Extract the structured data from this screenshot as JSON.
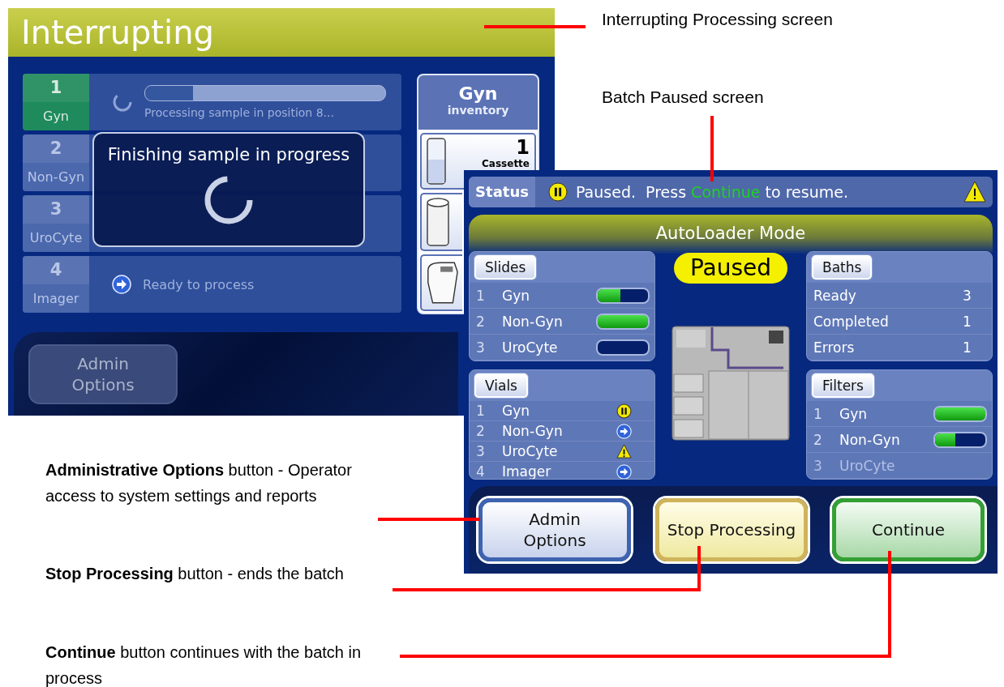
{
  "callouts": [
    {
      "text": "Interrupting Processing screen"
    },
    {
      "text": "Batch Paused screen"
    }
  ],
  "descriptions": [
    {
      "text": "**Administrative Options** button - Operator access to system settings and reports"
    },
    {
      "text": "**Stop Processing** button - ends the batch"
    },
    {
      "text": "**Continue** button continues with the batch in process"
    }
  ],
  "interrupting_screen": {
    "title": "Interrupting",
    "queues": [
      {
        "number": "1",
        "name": "Gyn",
        "selected": true,
        "kind": "progress",
        "message": "Processing sample in position 8...",
        "level": 0.2
      },
      {
        "number": "2",
        "name": "Non-Gyn",
        "selected": false,
        "kind": "hidden"
      },
      {
        "number": "3",
        "name": "UroCyte",
        "selected": false,
        "kind": "hidden"
      },
      {
        "number": "4",
        "name": "Imager",
        "selected": false,
        "kind": "ready",
        "message": "Ready to process"
      }
    ],
    "dialog": {
      "text": "Finishing sample in progress"
    },
    "inventory": {
      "title": "Gyn",
      "subtitle": "inventory",
      "count": "1",
      "item": "Cassette"
    },
    "admin_button": {
      "label": "Admin Options",
      "disabled": true
    }
  },
  "paused_screen": {
    "status_label": "Status",
    "status_parts": [
      {
        "text": "Paused.  Press ",
        "highlight": false
      },
      {
        "text": "Continue",
        "highlight": true
      },
      {
        "text": " to resume.",
        "highlight": false
      }
    ],
    "mode": "AutoLoader Mode",
    "state": "Paused",
    "slides": {
      "label": "Slides",
      "rows": [
        {
          "number": "1",
          "name": "Gyn",
          "level": 0.45
        },
        {
          "number": "2",
          "name": "Non-Gyn",
          "level": 1
        },
        {
          "number": "3",
          "name": "UroCyte",
          "level": 0
        }
      ]
    },
    "baths": {
      "label": "Baths",
      "rows": [
        {
          "name": "Ready",
          "value": "3"
        },
        {
          "name": "Completed",
          "value": "1"
        },
        {
          "name": "Errors",
          "value": "1"
        }
      ]
    },
    "vials": {
      "label": "Vials",
      "rows": [
        {
          "number": "1",
          "name": "Gyn",
          "kind": "paused"
        },
        {
          "number": "2",
          "name": "Non-Gyn",
          "kind": "ready"
        },
        {
          "number": "3",
          "name": "UroCyte",
          "kind": "warning"
        },
        {
          "number": "4",
          "name": "Imager",
          "kind": "ready"
        }
      ]
    },
    "filters": {
      "label": "Filters",
      "rows": [
        {
          "number": "1",
          "name": "Gyn",
          "level": 1,
          "disabled": false
        },
        {
          "number": "2",
          "name": "Non-Gyn",
          "level": 0.4,
          "disabled": false
        },
        {
          "number": "3",
          "name": "UroCyte",
          "disabled": true
        }
      ]
    },
    "buttons": [
      {
        "label": "Admin Options",
        "kind": "admin"
      },
      {
        "label": "Stop Processing",
        "kind": "stop"
      },
      {
        "label": "Continue",
        "kind": "continue"
      }
    ]
  }
}
